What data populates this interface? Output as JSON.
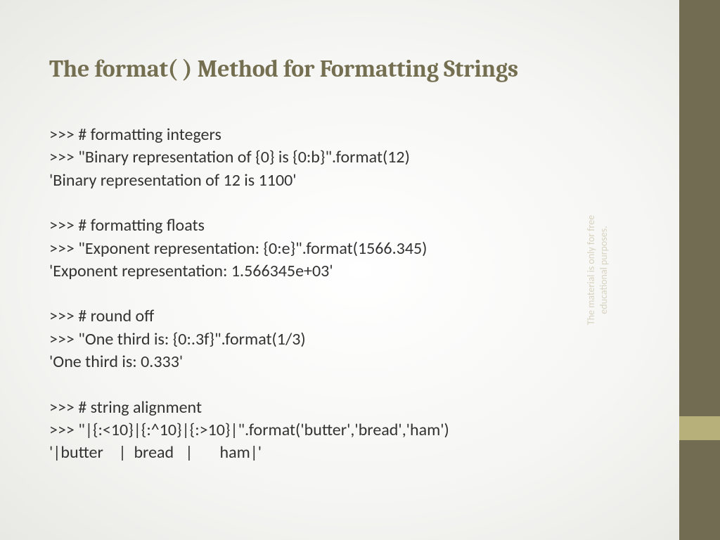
{
  "title": "The format( ) Method for Formatting Strings",
  "code": {
    "line1": ">>> # formatting integers",
    "line2": ">>> \"Binary representation of {0} is {0:b}\".format(12)",
    "line3": "'Binary representation of 12 is 1100'",
    "line4": ">>> # formatting floats",
    "line5": ">>> \"Exponent representation: {0:e}\".format(1566.345)",
    "line6": "'Exponent representation: 1.566345e+03'",
    "line7": ">>> # round off",
    "line8": ">>> \"One third is: {0:.3f}\".format(1/3)",
    "line9": "'One third is: 0.333'",
    "line10": ">>> # string alignment",
    "line11": ">>> \"|{:<10}|{:^10}|{:>10}|\".format('butter','bread','ham')",
    "line12": "'|butter    |  bread   |       ham|'"
  },
  "sidebar": {
    "text1": "The material is only for free",
    "text2": "educational purposes."
  }
}
